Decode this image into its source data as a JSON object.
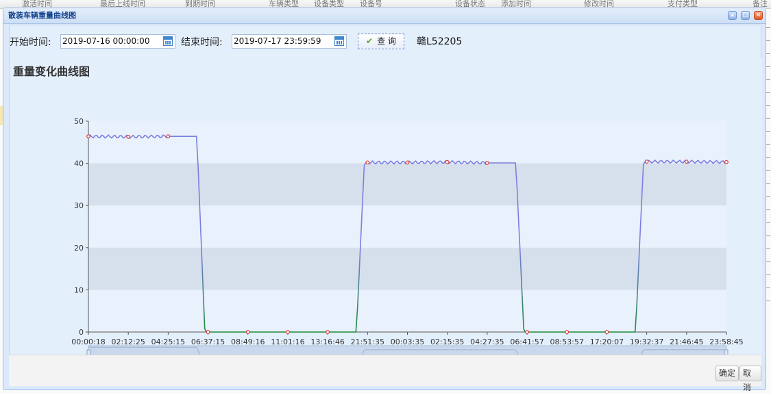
{
  "background_grid": {
    "headers": [
      "激活时间",
      "最后上线时间",
      "到期时间",
      "车辆类型",
      "设备类型",
      "设备号",
      "设备状态",
      "添加时间",
      "修改时间",
      "支付类型",
      "备注"
    ]
  },
  "dialog": {
    "title": "散装车辆重量曲线图",
    "search": {
      "start_label": "开始时间:",
      "start_value": "2019-07-16 00:00:00",
      "end_label": "结束时间:",
      "end_value": "2019-07-17 23:59:59",
      "query_label": "查 询",
      "plate": "赣L52205"
    },
    "chart_heading": "重量变化曲线图",
    "footer": {
      "ok_label": "确定",
      "cancel_label": "取消"
    }
  },
  "colors": {
    "line_high": "#7b7fe0",
    "line_low": "#1f8a3a",
    "point": "#e0302a",
    "band": "#d5e0ec",
    "plot_bg": "#e8f1fc"
  },
  "chart_data": {
    "type": "line",
    "title": "重量变化曲线图",
    "xlabel": "",
    "ylabel": "",
    "ylim": [
      0,
      50
    ],
    "yticks": [
      0,
      10,
      20,
      30,
      40,
      50
    ],
    "categories": [
      "00:00:18",
      "02:12:25",
      "04:25:15",
      "06:37:15",
      "08:49:16",
      "11:01:16",
      "13:16:46",
      "21:51:35",
      "00:03:35",
      "02:15:35",
      "04:27:35",
      "06:41:57",
      "08:53:57",
      "17:20:07",
      "19:32:37",
      "21:46:45",
      "23:58:45"
    ],
    "values": [
      46.4,
      46.3,
      46.4,
      0,
      0,
      0,
      0,
      40.2,
      40.2,
      40.3,
      40.1,
      0,
      0,
      0,
      40.4,
      40.4,
      40.3
    ],
    "grid": "alternating horizontal bands",
    "data_zoom": true
  }
}
